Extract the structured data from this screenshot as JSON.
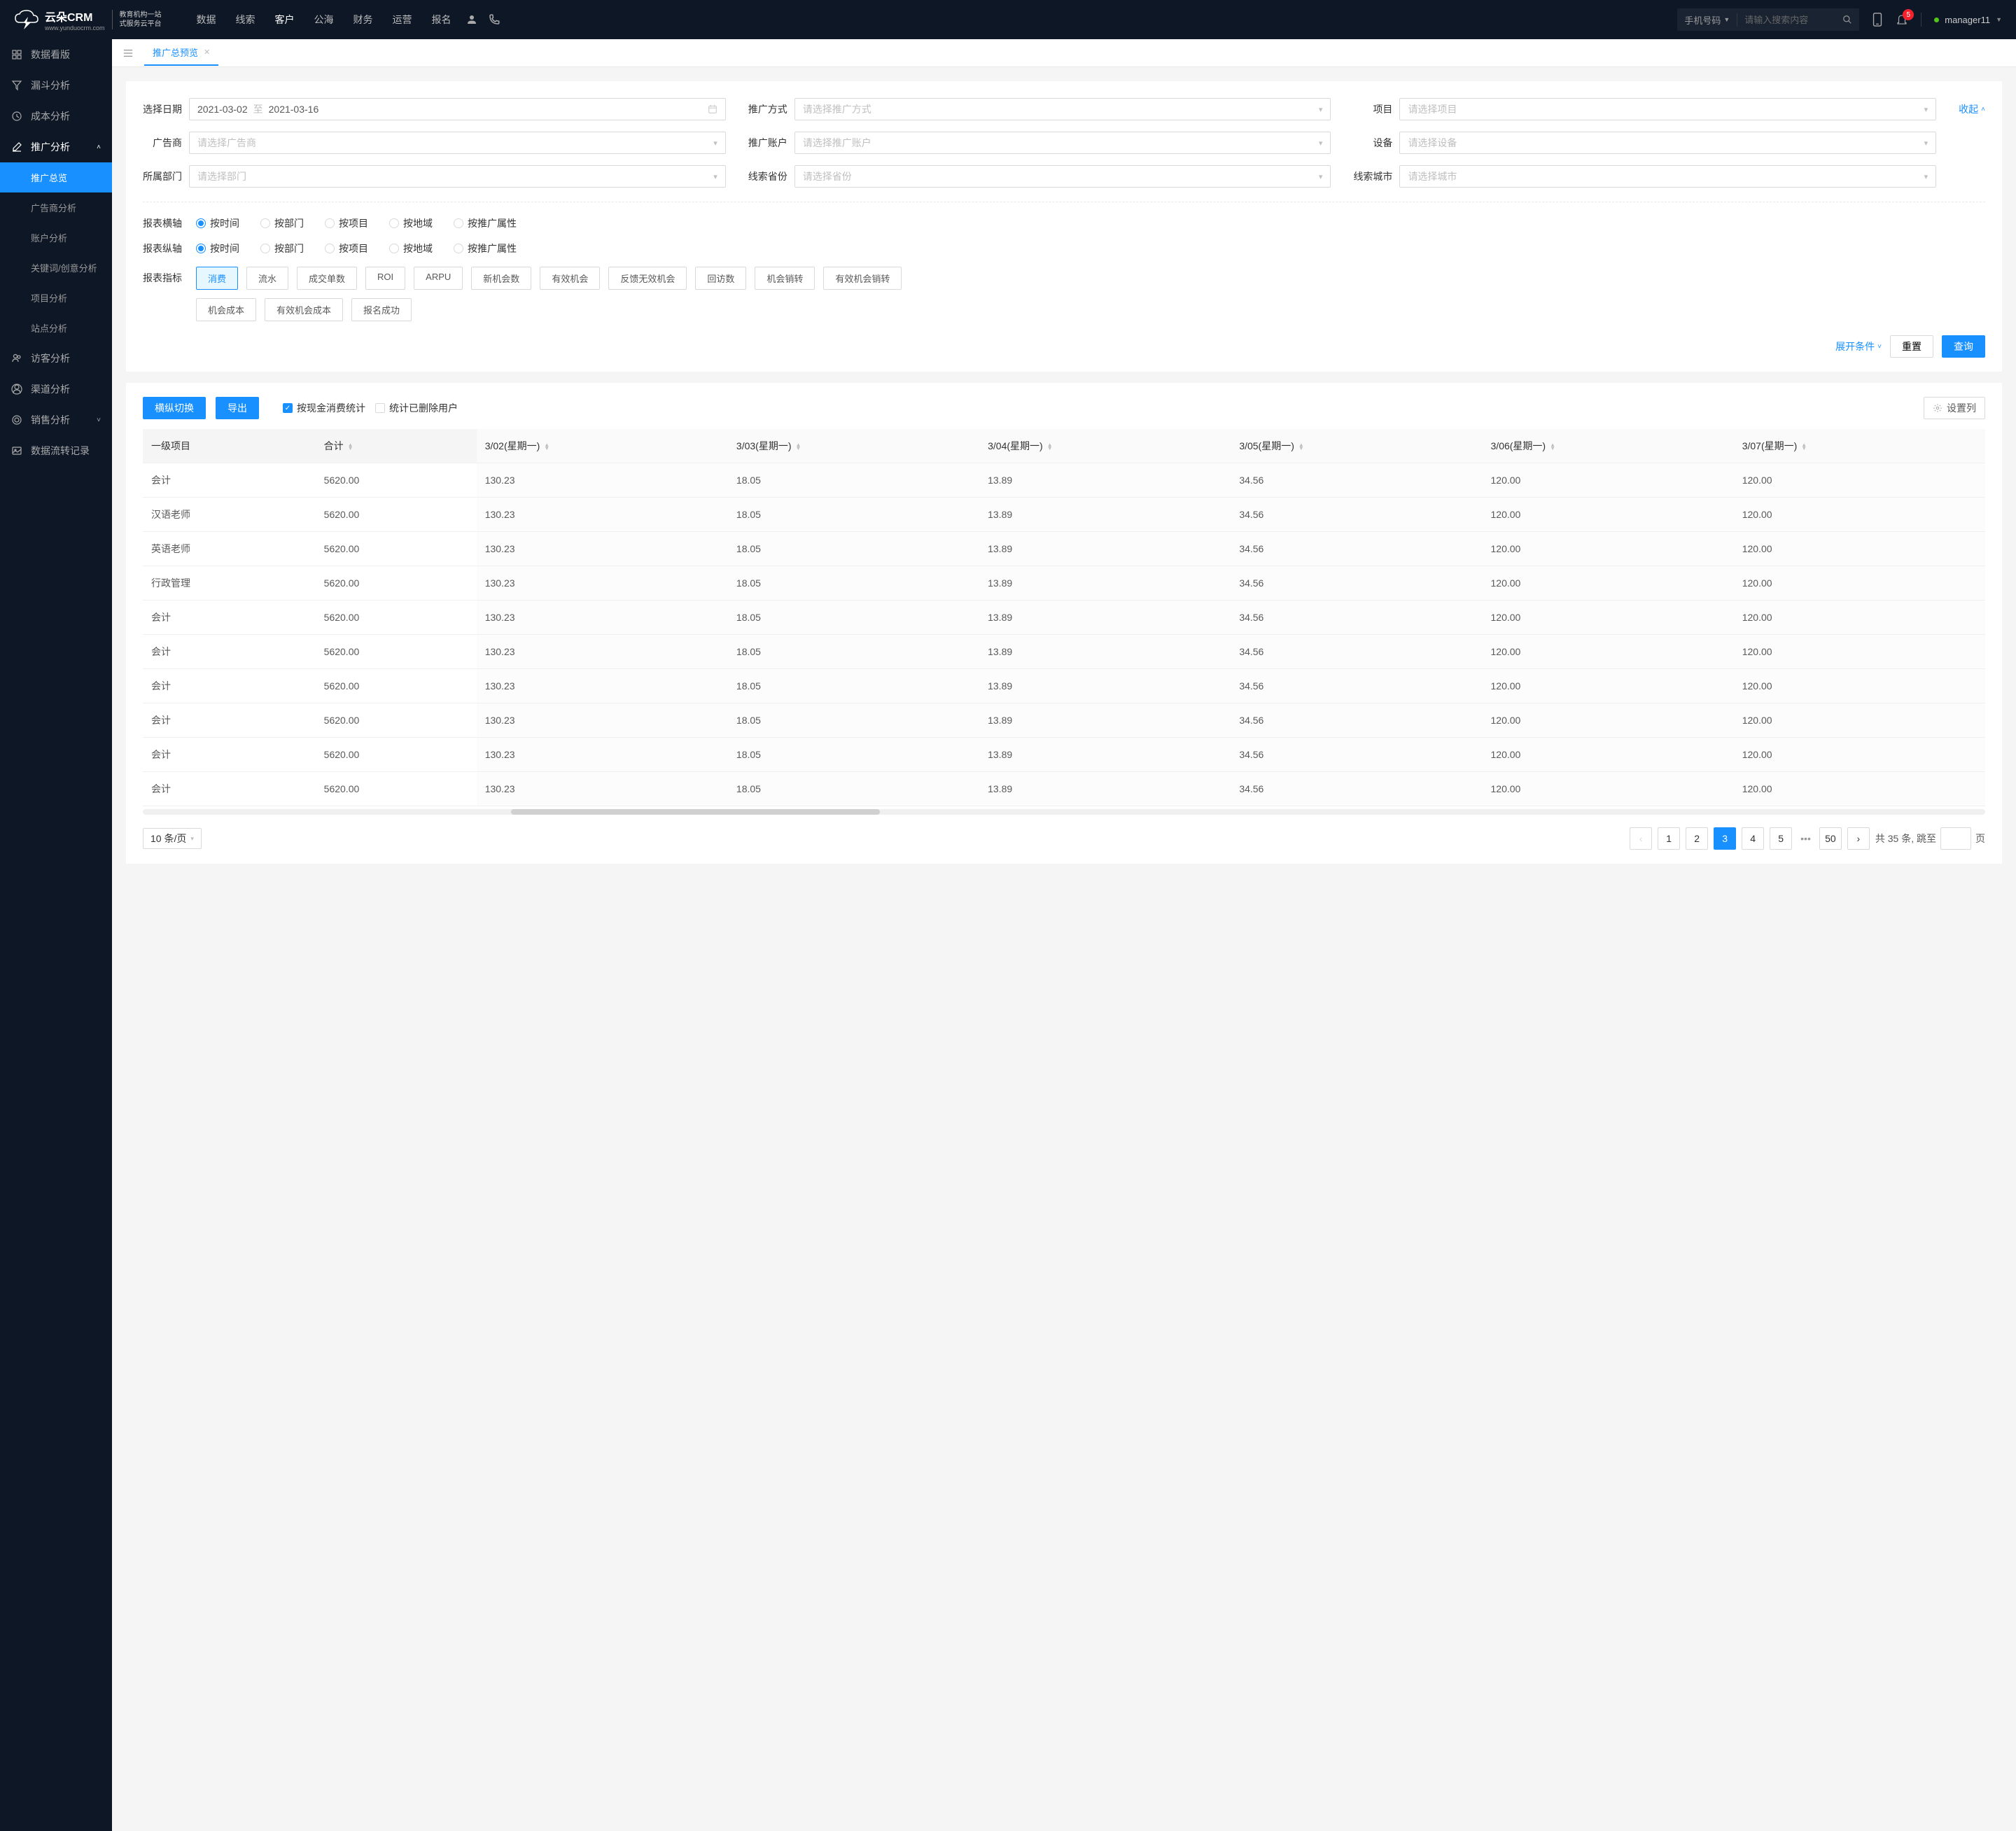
{
  "header": {
    "logo_main": "云朵CRM",
    "logo_url": "www.yunduocrm.com",
    "logo_desc1": "教育机构一站",
    "logo_desc2": "式服务云平台",
    "nav": [
      "数据",
      "线索",
      "客户",
      "公海",
      "财务",
      "运营",
      "报名"
    ],
    "active_nav": "客户",
    "search_type": "手机号码",
    "search_placeholder": "请输入搜索内容",
    "notification_count": "5",
    "username": "manager11"
  },
  "sidebar": {
    "items": [
      {
        "label": "数据看版",
        "icon": "dashboard"
      },
      {
        "label": "漏斗分析",
        "icon": "filter"
      },
      {
        "label": "成本分析",
        "icon": "clock"
      },
      {
        "label": "推广分析",
        "icon": "edit",
        "expanded": true,
        "children": [
          {
            "label": "推广总览",
            "active": true
          },
          {
            "label": "广告商分析"
          },
          {
            "label": "账户分析"
          },
          {
            "label": "关键词/创意分析"
          },
          {
            "label": "项目分析"
          },
          {
            "label": "站点分析"
          }
        ]
      },
      {
        "label": "访客分析",
        "icon": "team"
      },
      {
        "label": "渠道分析",
        "icon": "user"
      },
      {
        "label": "销售分析",
        "icon": "target",
        "collapsible": true
      },
      {
        "label": "数据流转记录",
        "icon": "picture"
      }
    ]
  },
  "tabs": {
    "active": "推广总预览"
  },
  "filters": {
    "date_label": "选择日期",
    "date_from": "2021-03-02",
    "date_sep": "至",
    "date_to": "2021-03-16",
    "method_label": "推广方式",
    "method_placeholder": "请选择推广方式",
    "project_label": "项目",
    "project_placeholder": "请选择项目",
    "advertiser_label": "广告商",
    "advertiser_placeholder": "请选择广告商",
    "account_label": "推广账户",
    "account_placeholder": "请选择推广账户",
    "device_label": "设备",
    "device_placeholder": "请选择设备",
    "dept_label": "所属部门",
    "dept_placeholder": "请选择部门",
    "province_label": "线索省份",
    "province_placeholder": "请选择省份",
    "city_label": "线索城市",
    "city_placeholder": "请选择城市",
    "collapse": "收起"
  },
  "axis": {
    "h_label": "报表横轴",
    "v_label": "报表纵轴",
    "options": [
      "按时间",
      "按部门",
      "按项目",
      "按地域",
      "按推广属性"
    ],
    "h_selected": "按时间",
    "v_selected": "按时间",
    "metric_label": "报表指标",
    "metrics_row1": [
      "消费",
      "流水",
      "成交单数",
      "ROI",
      "ARPU",
      "新机会数",
      "有效机会",
      "反馈无效机会",
      "回访数",
      "机会销转",
      "有效机会销转"
    ],
    "metrics_row2": [
      "机会成本",
      "有效机会成本",
      "报名成功"
    ],
    "metric_selected": "消费"
  },
  "actions": {
    "expand": "展开条件",
    "reset": "重置",
    "query": "查询"
  },
  "toolbar": {
    "switch": "横纵切换",
    "export": "导出",
    "cash": "按现金消费统计",
    "deleted": "统计已删除用户",
    "settings": "设置列"
  },
  "table": {
    "col1": "一级项目",
    "col2": "合计",
    "date_cols": [
      "3/02(星期一)",
      "3/03(星期一)",
      "3/04(星期一)",
      "3/05(星期一)",
      "3/06(星期一)",
      "3/07(星期一)"
    ],
    "rows": [
      {
        "name": "会计",
        "total": "5620.00",
        "vals": [
          "130.23",
          "18.05",
          "13.89",
          "34.56",
          "120.00",
          "120.00"
        ]
      },
      {
        "name": "汉语老师",
        "total": "5620.00",
        "vals": [
          "130.23",
          "18.05",
          "13.89",
          "34.56",
          "120.00",
          "120.00"
        ]
      },
      {
        "name": "英语老师",
        "total": "5620.00",
        "vals": [
          "130.23",
          "18.05",
          "13.89",
          "34.56",
          "120.00",
          "120.00"
        ]
      },
      {
        "name": "行政管理",
        "total": "5620.00",
        "vals": [
          "130.23",
          "18.05",
          "13.89",
          "34.56",
          "120.00",
          "120.00"
        ]
      },
      {
        "name": "会计",
        "total": "5620.00",
        "vals": [
          "130.23",
          "18.05",
          "13.89",
          "34.56",
          "120.00",
          "120.00"
        ]
      },
      {
        "name": "会计",
        "total": "5620.00",
        "vals": [
          "130.23",
          "18.05",
          "13.89",
          "34.56",
          "120.00",
          "120.00"
        ]
      },
      {
        "name": "会计",
        "total": "5620.00",
        "vals": [
          "130.23",
          "18.05",
          "13.89",
          "34.56",
          "120.00",
          "120.00"
        ]
      },
      {
        "name": "会计",
        "total": "5620.00",
        "vals": [
          "130.23",
          "18.05",
          "13.89",
          "34.56",
          "120.00",
          "120.00"
        ]
      },
      {
        "name": "会计",
        "total": "5620.00",
        "vals": [
          "130.23",
          "18.05",
          "13.89",
          "34.56",
          "120.00",
          "120.00"
        ]
      },
      {
        "name": "会计",
        "total": "5620.00",
        "vals": [
          "130.23",
          "18.05",
          "13.89",
          "34.56",
          "120.00",
          "120.00"
        ]
      }
    ]
  },
  "pagination": {
    "page_size": "10 条/页",
    "pages": [
      "1",
      "2",
      "3",
      "4",
      "5"
    ],
    "last": "50",
    "active": "3",
    "total_prefix": "共 35 条,",
    "jump_label": "跳至",
    "jump_suffix": "页"
  }
}
